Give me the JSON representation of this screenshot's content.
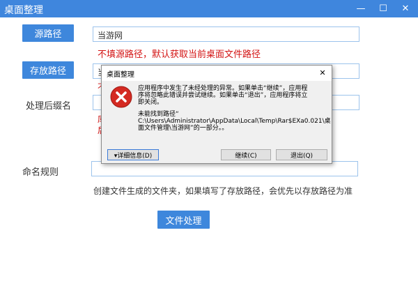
{
  "window": {
    "title": "桌面整理",
    "minimize": "—",
    "maximize": "☐",
    "close": "✕"
  },
  "source": {
    "button": "源路径",
    "value": "当游网",
    "hint": "不填源路径，默认获取当前桌面文件路径"
  },
  "store": {
    "button": "存放路径",
    "value": "当",
    "fragment_a": "不",
    "fragment_b": "库",
    "fragment_c": "后"
  },
  "suffix": {
    "label": "处理后缀名"
  },
  "naming": {
    "label": "命名规则",
    "note": "创建文件生成的文件夹，如果填写了存放路径，会优先以存放路径为准"
  },
  "process_button": "文件处理",
  "dialog": {
    "title": "桌面整理",
    "close": "✕",
    "message1": "应用程序中发生了未经处理的异常。如果单击“继续”，应用程\n序将忽略此错误并尝试继续。如果单击“退出”，应用程序将立\n即关闭。",
    "message2": "未能找到路径“\nC:\\Users\\Administrator\\AppData\\Local\\Temp\\Rar$EXa0.021\\桌\n面文件管理\\当游网”的一部分。。",
    "details_button": "▾详细信息(D)",
    "continue_button": "继续(C)",
    "exit_button": "退出(Q)"
  }
}
